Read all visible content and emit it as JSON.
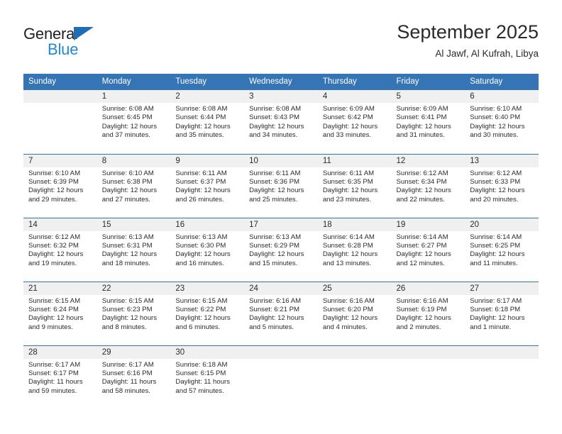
{
  "brand": {
    "name_part1": "General",
    "name_part2": "Blue",
    "triangle_icon": "triangle-icon",
    "colors": {
      "dark": "#231f20",
      "blue": "#2389d6",
      "triangle": "#1f6db5"
    }
  },
  "header": {
    "title": "September 2025",
    "subtitle": "Al Jawf, Al Kufrah, Libya"
  },
  "theme": {
    "header_bg": "#3575b5",
    "daynum_bg": "#f0f0f0",
    "separator": "#3575b5",
    "text": "#2b2b2b"
  },
  "columns": [
    "Sunday",
    "Monday",
    "Tuesday",
    "Wednesday",
    "Thursday",
    "Friday",
    "Saturday"
  ],
  "weeks": [
    [
      {
        "day": "",
        "sunrise": "",
        "sunset": "",
        "daylight1": "",
        "daylight2": ""
      },
      {
        "day": "1",
        "sunrise": "Sunrise: 6:08 AM",
        "sunset": "Sunset: 6:45 PM",
        "daylight1": "Daylight: 12 hours",
        "daylight2": "and 37 minutes."
      },
      {
        "day": "2",
        "sunrise": "Sunrise: 6:08 AM",
        "sunset": "Sunset: 6:44 PM",
        "daylight1": "Daylight: 12 hours",
        "daylight2": "and 35 minutes."
      },
      {
        "day": "3",
        "sunrise": "Sunrise: 6:08 AM",
        "sunset": "Sunset: 6:43 PM",
        "daylight1": "Daylight: 12 hours",
        "daylight2": "and 34 minutes."
      },
      {
        "day": "4",
        "sunrise": "Sunrise: 6:09 AM",
        "sunset": "Sunset: 6:42 PM",
        "daylight1": "Daylight: 12 hours",
        "daylight2": "and 33 minutes."
      },
      {
        "day": "5",
        "sunrise": "Sunrise: 6:09 AM",
        "sunset": "Sunset: 6:41 PM",
        "daylight1": "Daylight: 12 hours",
        "daylight2": "and 31 minutes."
      },
      {
        "day": "6",
        "sunrise": "Sunrise: 6:10 AM",
        "sunset": "Sunset: 6:40 PM",
        "daylight1": "Daylight: 12 hours",
        "daylight2": "and 30 minutes."
      }
    ],
    [
      {
        "day": "7",
        "sunrise": "Sunrise: 6:10 AM",
        "sunset": "Sunset: 6:39 PM",
        "daylight1": "Daylight: 12 hours",
        "daylight2": "and 29 minutes."
      },
      {
        "day": "8",
        "sunrise": "Sunrise: 6:10 AM",
        "sunset": "Sunset: 6:38 PM",
        "daylight1": "Daylight: 12 hours",
        "daylight2": "and 27 minutes."
      },
      {
        "day": "9",
        "sunrise": "Sunrise: 6:11 AM",
        "sunset": "Sunset: 6:37 PM",
        "daylight1": "Daylight: 12 hours",
        "daylight2": "and 26 minutes."
      },
      {
        "day": "10",
        "sunrise": "Sunrise: 6:11 AM",
        "sunset": "Sunset: 6:36 PM",
        "daylight1": "Daylight: 12 hours",
        "daylight2": "and 25 minutes."
      },
      {
        "day": "11",
        "sunrise": "Sunrise: 6:11 AM",
        "sunset": "Sunset: 6:35 PM",
        "daylight1": "Daylight: 12 hours",
        "daylight2": "and 23 minutes."
      },
      {
        "day": "12",
        "sunrise": "Sunrise: 6:12 AM",
        "sunset": "Sunset: 6:34 PM",
        "daylight1": "Daylight: 12 hours",
        "daylight2": "and 22 minutes."
      },
      {
        "day": "13",
        "sunrise": "Sunrise: 6:12 AM",
        "sunset": "Sunset: 6:33 PM",
        "daylight1": "Daylight: 12 hours",
        "daylight2": "and 20 minutes."
      }
    ],
    [
      {
        "day": "14",
        "sunrise": "Sunrise: 6:12 AM",
        "sunset": "Sunset: 6:32 PM",
        "daylight1": "Daylight: 12 hours",
        "daylight2": "and 19 minutes."
      },
      {
        "day": "15",
        "sunrise": "Sunrise: 6:13 AM",
        "sunset": "Sunset: 6:31 PM",
        "daylight1": "Daylight: 12 hours",
        "daylight2": "and 18 minutes."
      },
      {
        "day": "16",
        "sunrise": "Sunrise: 6:13 AM",
        "sunset": "Sunset: 6:30 PM",
        "daylight1": "Daylight: 12 hours",
        "daylight2": "and 16 minutes."
      },
      {
        "day": "17",
        "sunrise": "Sunrise: 6:13 AM",
        "sunset": "Sunset: 6:29 PM",
        "daylight1": "Daylight: 12 hours",
        "daylight2": "and 15 minutes."
      },
      {
        "day": "18",
        "sunrise": "Sunrise: 6:14 AM",
        "sunset": "Sunset: 6:28 PM",
        "daylight1": "Daylight: 12 hours",
        "daylight2": "and 13 minutes."
      },
      {
        "day": "19",
        "sunrise": "Sunrise: 6:14 AM",
        "sunset": "Sunset: 6:27 PM",
        "daylight1": "Daylight: 12 hours",
        "daylight2": "and 12 minutes."
      },
      {
        "day": "20",
        "sunrise": "Sunrise: 6:14 AM",
        "sunset": "Sunset: 6:25 PM",
        "daylight1": "Daylight: 12 hours",
        "daylight2": "and 11 minutes."
      }
    ],
    [
      {
        "day": "21",
        "sunrise": "Sunrise: 6:15 AM",
        "sunset": "Sunset: 6:24 PM",
        "daylight1": "Daylight: 12 hours",
        "daylight2": "and 9 minutes."
      },
      {
        "day": "22",
        "sunrise": "Sunrise: 6:15 AM",
        "sunset": "Sunset: 6:23 PM",
        "daylight1": "Daylight: 12 hours",
        "daylight2": "and 8 minutes."
      },
      {
        "day": "23",
        "sunrise": "Sunrise: 6:15 AM",
        "sunset": "Sunset: 6:22 PM",
        "daylight1": "Daylight: 12 hours",
        "daylight2": "and 6 minutes."
      },
      {
        "day": "24",
        "sunrise": "Sunrise: 6:16 AM",
        "sunset": "Sunset: 6:21 PM",
        "daylight1": "Daylight: 12 hours",
        "daylight2": "and 5 minutes."
      },
      {
        "day": "25",
        "sunrise": "Sunrise: 6:16 AM",
        "sunset": "Sunset: 6:20 PM",
        "daylight1": "Daylight: 12 hours",
        "daylight2": "and 4 minutes."
      },
      {
        "day": "26",
        "sunrise": "Sunrise: 6:16 AM",
        "sunset": "Sunset: 6:19 PM",
        "daylight1": "Daylight: 12 hours",
        "daylight2": "and 2 minutes."
      },
      {
        "day": "27",
        "sunrise": "Sunrise: 6:17 AM",
        "sunset": "Sunset: 6:18 PM",
        "daylight1": "Daylight: 12 hours",
        "daylight2": "and 1 minute."
      }
    ],
    [
      {
        "day": "28",
        "sunrise": "Sunrise: 6:17 AM",
        "sunset": "Sunset: 6:17 PM",
        "daylight1": "Daylight: 11 hours",
        "daylight2": "and 59 minutes."
      },
      {
        "day": "29",
        "sunrise": "Sunrise: 6:17 AM",
        "sunset": "Sunset: 6:16 PM",
        "daylight1": "Daylight: 11 hours",
        "daylight2": "and 58 minutes."
      },
      {
        "day": "30",
        "sunrise": "Sunrise: 6:18 AM",
        "sunset": "Sunset: 6:15 PM",
        "daylight1": "Daylight: 11 hours",
        "daylight2": "and 57 minutes."
      },
      {
        "day": "",
        "sunrise": "",
        "sunset": "",
        "daylight1": "",
        "daylight2": ""
      },
      {
        "day": "",
        "sunrise": "",
        "sunset": "",
        "daylight1": "",
        "daylight2": ""
      },
      {
        "day": "",
        "sunrise": "",
        "sunset": "",
        "daylight1": "",
        "daylight2": ""
      },
      {
        "day": "",
        "sunrise": "",
        "sunset": "",
        "daylight1": "",
        "daylight2": ""
      }
    ]
  ]
}
